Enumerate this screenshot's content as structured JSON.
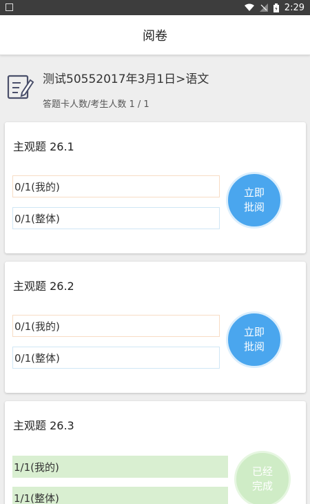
{
  "status_bar": {
    "time": "2:29"
  },
  "app_bar": {
    "title": "阅卷"
  },
  "exam": {
    "title": "测试50552017年3月1日>语文",
    "count_label": "答题卡人数/考生人数 1 / 1"
  },
  "questions": [
    {
      "title": "主观题  26.1",
      "mine": "0/1(我的)",
      "all": "0/1(整体)",
      "action": "立即批阅",
      "status": "active"
    },
    {
      "title": "主观题  26.2",
      "mine": "0/1(我的)",
      "all": "0/1(整体)",
      "action": "立即批阅",
      "status": "active"
    },
    {
      "title": "主观题  26.3",
      "mine": "1/1(我的)",
      "all": "1/1(整体)",
      "action": "已经完成",
      "status": "finished"
    }
  ],
  "colors": {
    "accent_blue": "#4aa6ee",
    "done_green": "#cfecc6",
    "mine_border": "#f7dcc4",
    "all_border": "#cfe6f5"
  }
}
